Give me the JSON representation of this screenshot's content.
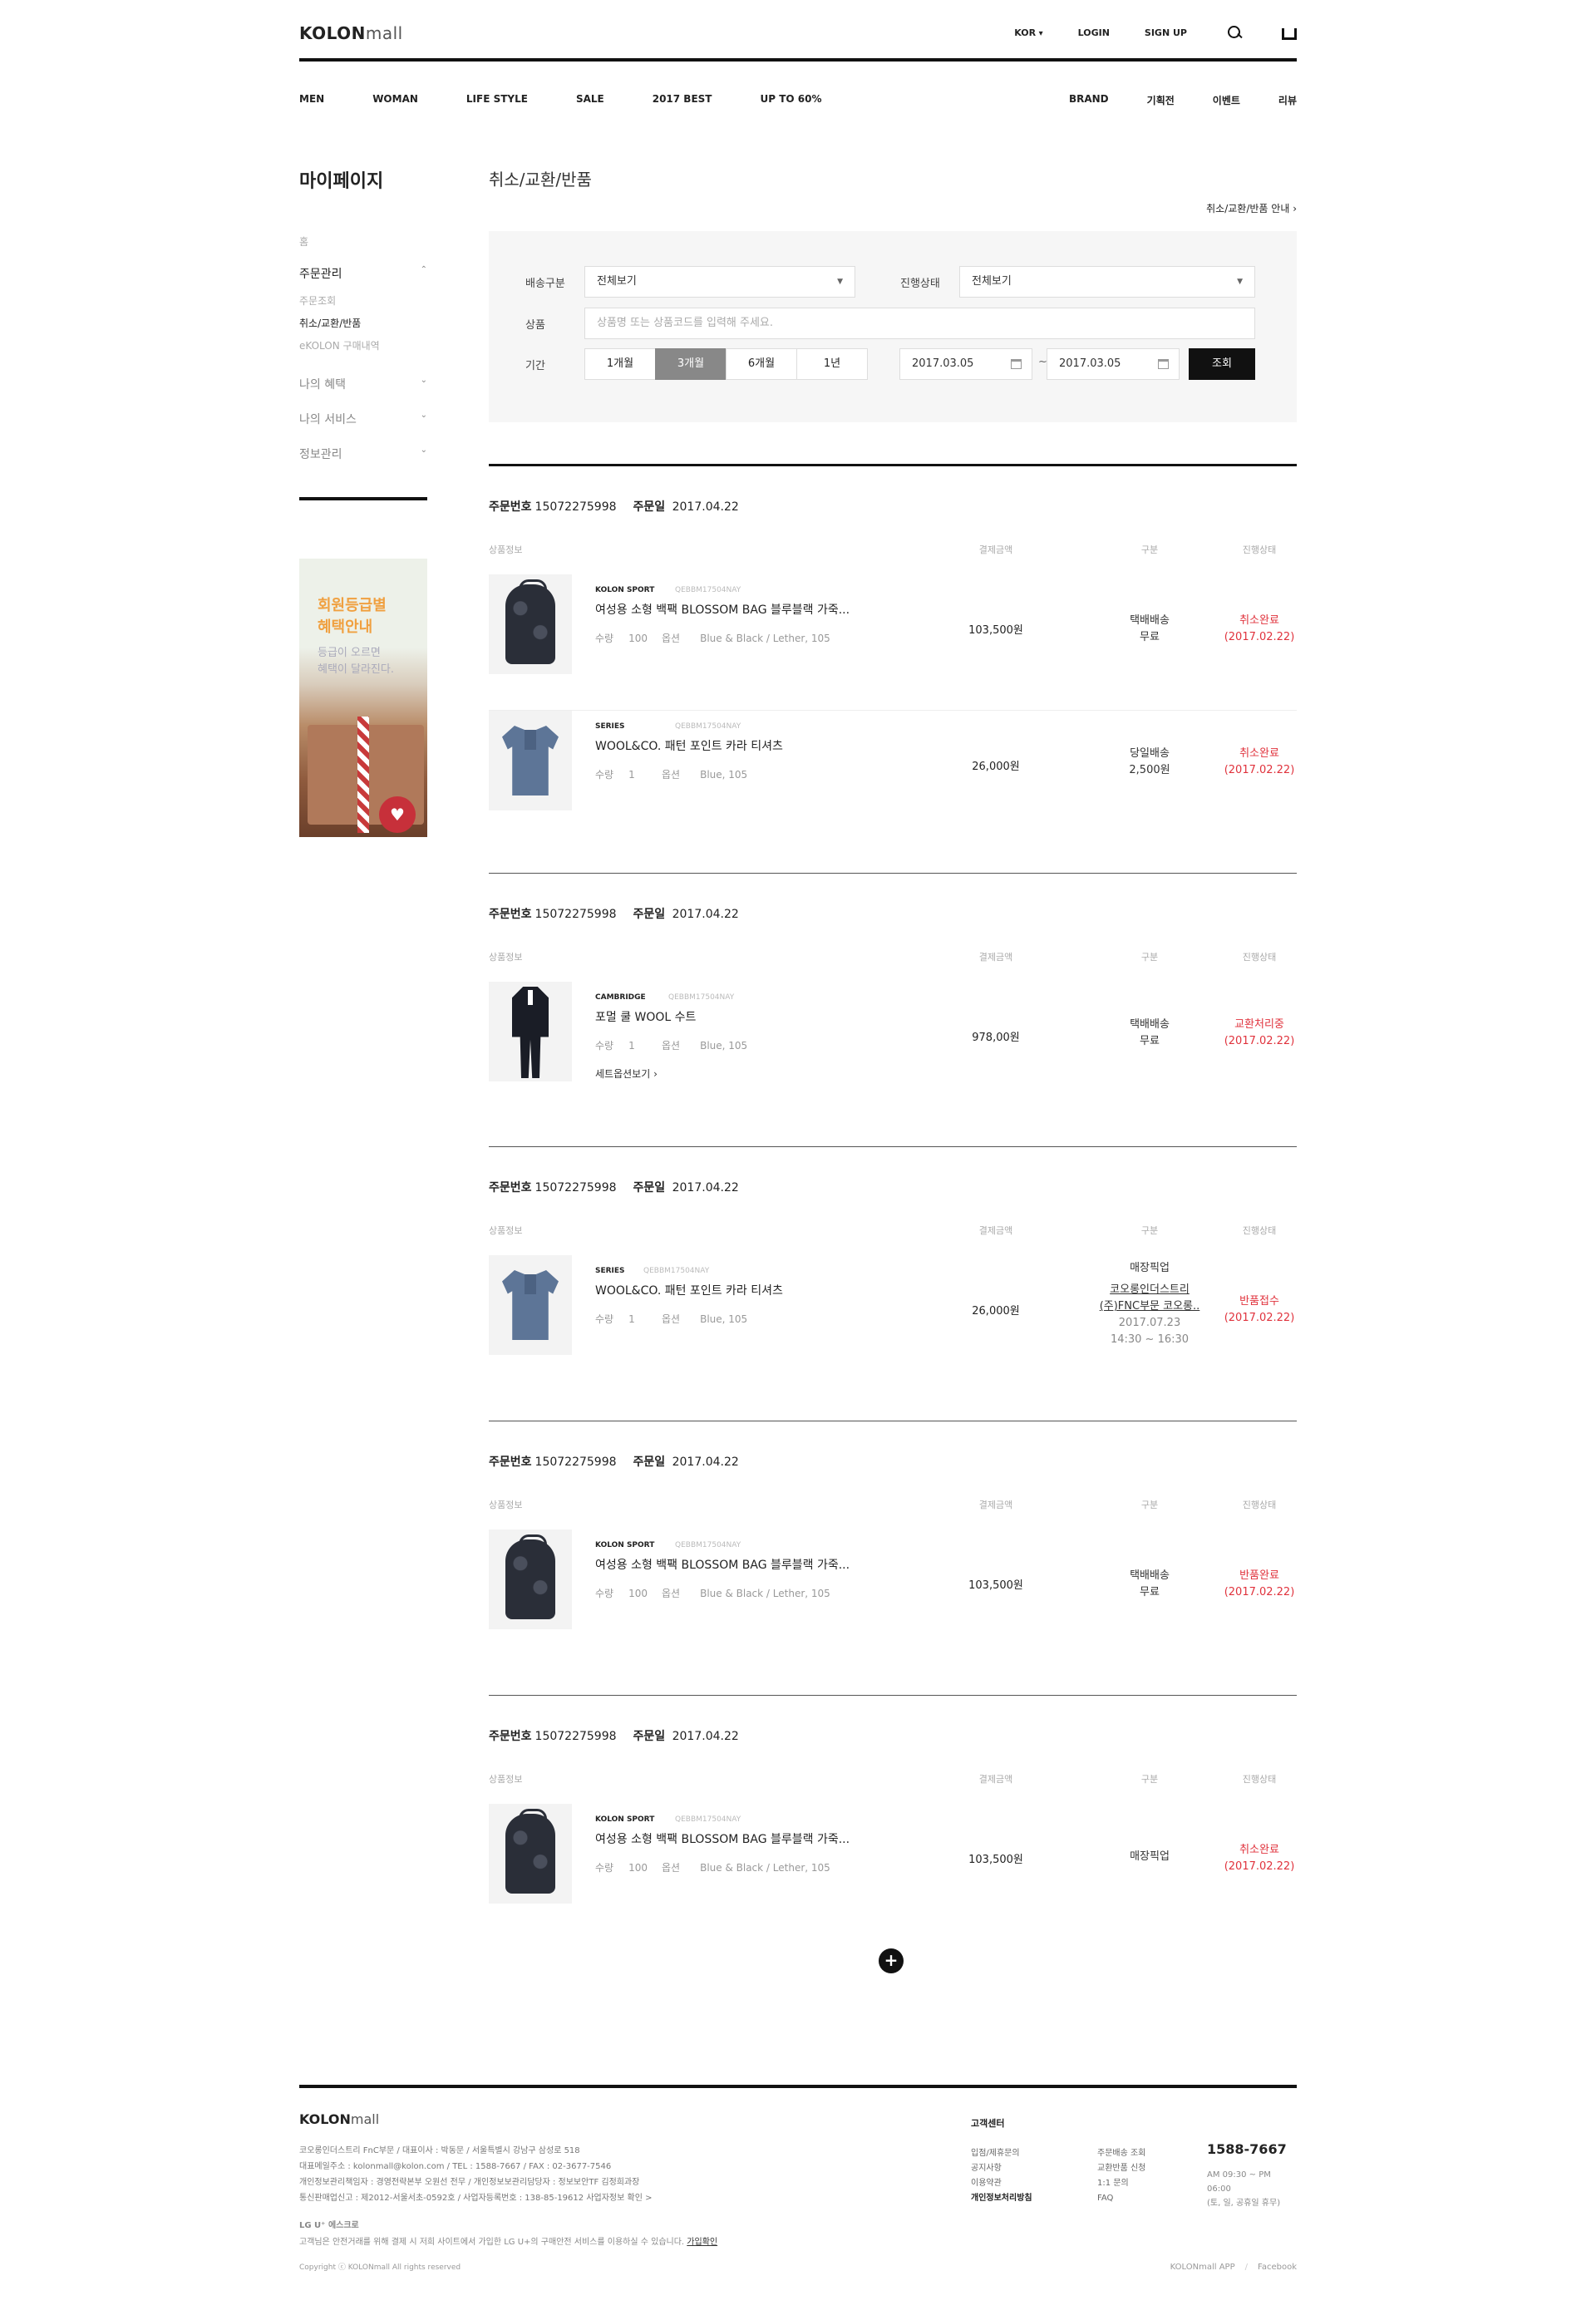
{
  "header": {
    "logo_brand": "KOLON",
    "logo_suffix": "mall",
    "lang": "KOR",
    "login": "LOGIN",
    "signup": "SIGN UP",
    "icons": [
      "search-icon",
      "bag-icon"
    ]
  },
  "gnb": {
    "left": [
      "MEN",
      "WOMAN",
      "LIFE STYLE",
      "SALE",
      "2017 BEST",
      "UP TO 60%"
    ],
    "right": [
      "BRAND",
      "기획전",
      "이벤트",
      "리뷰"
    ]
  },
  "sidebar": {
    "title": "마이페이지",
    "home": "홈",
    "group_order": "주문관리",
    "subs": [
      "주문조회",
      "취소/교환/반품",
      "eKOLON 구매내역"
    ],
    "groups": [
      "나의 혜택",
      "나의 서비스",
      "정보관리"
    ],
    "banner_title1": "회원등급별",
    "banner_title2": "혜택안내",
    "banner_desc1": "등급이 오르면",
    "banner_desc2": "혜택이 달라진다."
  },
  "page": {
    "title": "취소/교환/반품",
    "guide_link": "취소/교환/반품 안내"
  },
  "filter": {
    "ship_label": "배송구분",
    "ship_value": "전체보기",
    "status_label": "진행상태",
    "status_value": "전체보기",
    "product_label": "상품",
    "product_placeholder": "상품명 또는 상품코드를 입력해 주세요.",
    "period_label": "기간",
    "periods": [
      "1개월",
      "3개월",
      "6개월",
      "1년"
    ],
    "period_selected": "3개월",
    "date_from": "2017.03.05",
    "date_tilde": "~",
    "date_to": "2017.03.05",
    "search": "조회"
  },
  "columns": {
    "info": "상품정보",
    "price": "결제금액",
    "type": "구분",
    "status": "진행상태"
  },
  "order_labels": {
    "no": "주문번호",
    "date": "주문일",
    "qty": "수량",
    "opt": "옵션"
  },
  "orders": [
    {
      "no": "15072275998",
      "date": "2017.04.22",
      "items": [
        {
          "brand": "KOLON SPORT",
          "code": "QEBBM17504NAY",
          "name": "여성용 소형 백팩 BLOSSOM BAG 블루블랙 가죽...",
          "qty": "100",
          "opt": "Blue & Black / Lether, 105",
          "price": "103,500원",
          "ship1": "택배배송",
          "ship2": "무료",
          "status1": "취소완료",
          "status2": "(2017.02.22)"
        },
        {
          "brand": "SERIES",
          "code": "QEBBM17504NAY",
          "name": "WOOL&CO. 패턴 포인트 카라 티셔츠",
          "qty": "1",
          "opt": "Blue, 105",
          "price": "26,000원",
          "ship1": "당일배송",
          "ship2": "2,500원",
          "status1": "취소완료",
          "status2": "(2017.02.22)"
        }
      ]
    },
    {
      "no": "15072275998",
      "date": "2017.04.22",
      "items": [
        {
          "brand": "CAMBRIDGE",
          "code": "QEBBM17504NAY",
          "name": "포멀 쿨 WOOL 수트",
          "qty": "1",
          "opt": "Blue, 105",
          "set_option": "세트옵션보기",
          "price": "978,00원",
          "ship1": "택배배송",
          "ship2": "무료",
          "status1": "교환처리중",
          "status2": "(2017.02.22)"
        }
      ]
    },
    {
      "no": "15072275998",
      "date": "2017.04.22",
      "items": [
        {
          "brand": "SERIES",
          "code": "QEBBM17504NAY",
          "name": "WOOL&CO. 패턴 포인트 카라 티셔츠",
          "qty": "1",
          "opt": "Blue, 105",
          "price": "26,000원",
          "ship1": "매장픽업",
          "pickup1": "코오롱인더스트리",
          "pickup2": "(주)FNC부문 코오롱..",
          "pickup3": "2017.07.23",
          "pickup4": "14:30 ~ 16:30",
          "status1": "반품접수",
          "status2": "(2017.02.22)"
        }
      ]
    },
    {
      "no": "15072275998",
      "date": "2017.04.22",
      "items": [
        {
          "brand": "KOLON SPORT",
          "code": "QEBBM17504NAY",
          "name": "여성용 소형 백팩 BLOSSOM BAG 블루블랙 가죽...",
          "qty": "100",
          "opt": "Blue & Black / Lether, 105",
          "price": "103,500원",
          "ship1": "택배배송",
          "ship2": "무료",
          "status1": "반품완료",
          "status2": "(2017.02.22)"
        }
      ]
    },
    {
      "no": "15072275998",
      "date": "2017.04.22",
      "items": [
        {
          "brand": "KOLON SPORT",
          "code": "QEBBM17504NAY",
          "name": "여성용 소형 백팩 BLOSSOM BAG 블루블랙 가죽...",
          "qty": "100",
          "opt": "Blue & Black / Lether, 105",
          "price": "103,500원",
          "ship1": "매장픽업",
          "status1": "취소완료",
          "status2": "(2017.02.22)"
        }
      ]
    }
  ],
  "more_button": "+",
  "footer": {
    "logo_brand": "KOLON",
    "logo_suffix": "mall",
    "info1": "코오롱인더스트리 FnC부문 / 대표이사 : 박동문 / 서울특별시 강남구 삼성로 518",
    "info2": "대표메일주소 : kolonmall@kolon.com / TEL : 1588-7667 / FAX : 02-3677-7546",
    "info3": "개인정보관리책임자 : 경영전략본부 오원선 전무 / 개인정보보관리담당자 : 정보보안TF 김정희과장",
    "info4": "통신판매업신고 : 제2012-서울서초-0592호 / 사업자등록번호 : 138-85-19612 사업자정보 확인 >",
    "lgu": "LG U⁺ 에스크로",
    "lgu_desc": "고객님은 안전거래를 위해 결제 시 저희 사이트에서 가입한 LG U+의 구매안전 서비스를 이용하실 수 있습니다.",
    "lgu_link": "가입확인",
    "copyright": "Copyright ⓒ KOLONmall All rights reserved",
    "cc_title": "고객센터",
    "cc_col1": [
      "입점/제휴문의",
      "공지사항",
      "이용약관",
      "개인정보처리방침"
    ],
    "cc_col2": [
      "주문배송 조회",
      "교환반품 신청",
      "1:1 문의",
      "FAQ"
    ],
    "tel": "1588-7667",
    "hours1": "AM 09:30 ~ PM 06:00",
    "hours2": "(토, 일, 공휴일 휴무)",
    "link_app": "KOLONmall APP",
    "link_fb": "Facebook"
  }
}
